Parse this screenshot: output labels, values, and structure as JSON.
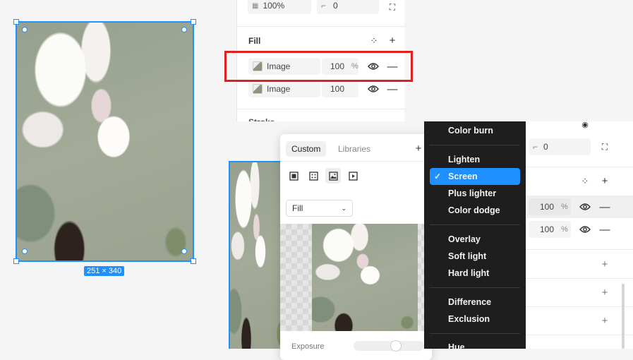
{
  "canvas": {
    "size_label": "251 × 340"
  },
  "top_fields": {
    "opacity_value": "100%",
    "corner_value": "0"
  },
  "fill_section": {
    "title": "Fill",
    "layers": [
      {
        "label": "Image",
        "opacity": "100",
        "unit": "%"
      },
      {
        "label": "Image",
        "opacity": "100",
        "unit": "%"
      }
    ]
  },
  "stroke_section_peek": "Stroke",
  "right_panel": {
    "corner_value": "0",
    "layers": [
      {
        "opacity": "100",
        "unit": "%"
      },
      {
        "opacity": "100",
        "unit": "%"
      }
    ]
  },
  "picker": {
    "tabs": [
      {
        "label": "Custom"
      },
      {
        "label": "Libraries"
      }
    ],
    "add_label": "+",
    "mode_select": "Fill",
    "exposure_label": "Exposure"
  },
  "blend_menu": {
    "items": [
      {
        "label": "Color burn",
        "selected": false
      },
      {
        "label": "Lighten",
        "selected": false
      },
      {
        "label": "Screen",
        "selected": true
      },
      {
        "label": "Plus lighter",
        "selected": false
      },
      {
        "label": "Color dodge",
        "selected": false
      },
      {
        "label": "Overlay",
        "selected": false
      },
      {
        "label": "Soft light",
        "selected": false
      },
      {
        "label": "Hard light",
        "selected": false
      },
      {
        "label": "Difference",
        "selected": false
      },
      {
        "label": "Exclusion",
        "selected": false
      },
      {
        "label": "Hue",
        "selected": false
      }
    ],
    "check_glyph": "✓"
  },
  "colors": {
    "selection": "#1e90ff",
    "highlight_box": "#e02020",
    "menu_bg": "#1e1e1e"
  }
}
